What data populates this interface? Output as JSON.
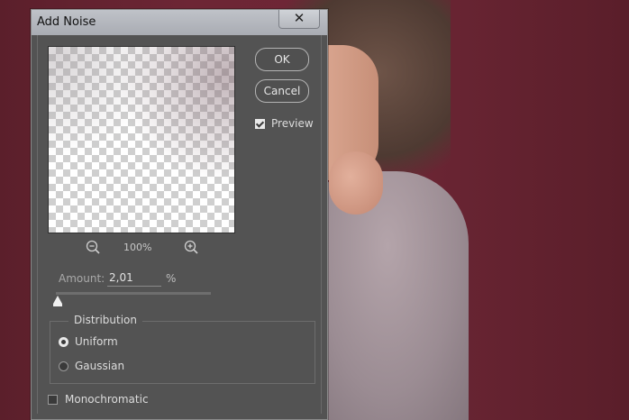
{
  "dialog": {
    "title": "Add Noise",
    "close_glyph": "✕",
    "ok_label": "OK",
    "cancel_label": "Cancel",
    "preview_label": "Preview",
    "preview_checked": true,
    "zoom": "100%",
    "zoom_out_icon": "zoom-out-icon",
    "zoom_in_icon": "zoom-in-icon",
    "amount": {
      "label": "Amount:",
      "value": "2,01",
      "unit": "%"
    },
    "distribution": {
      "label": "Distribution",
      "options": [
        {
          "label": "Uniform",
          "selected": true
        },
        {
          "label": "Gaussian",
          "selected": false
        }
      ]
    },
    "monochromatic": {
      "label": "Monochromatic",
      "checked": false
    }
  },
  "colors": {
    "dialog_bg": "#535353",
    "titlebar": "#b0b3b9",
    "photo_bg": "#6a2532"
  }
}
